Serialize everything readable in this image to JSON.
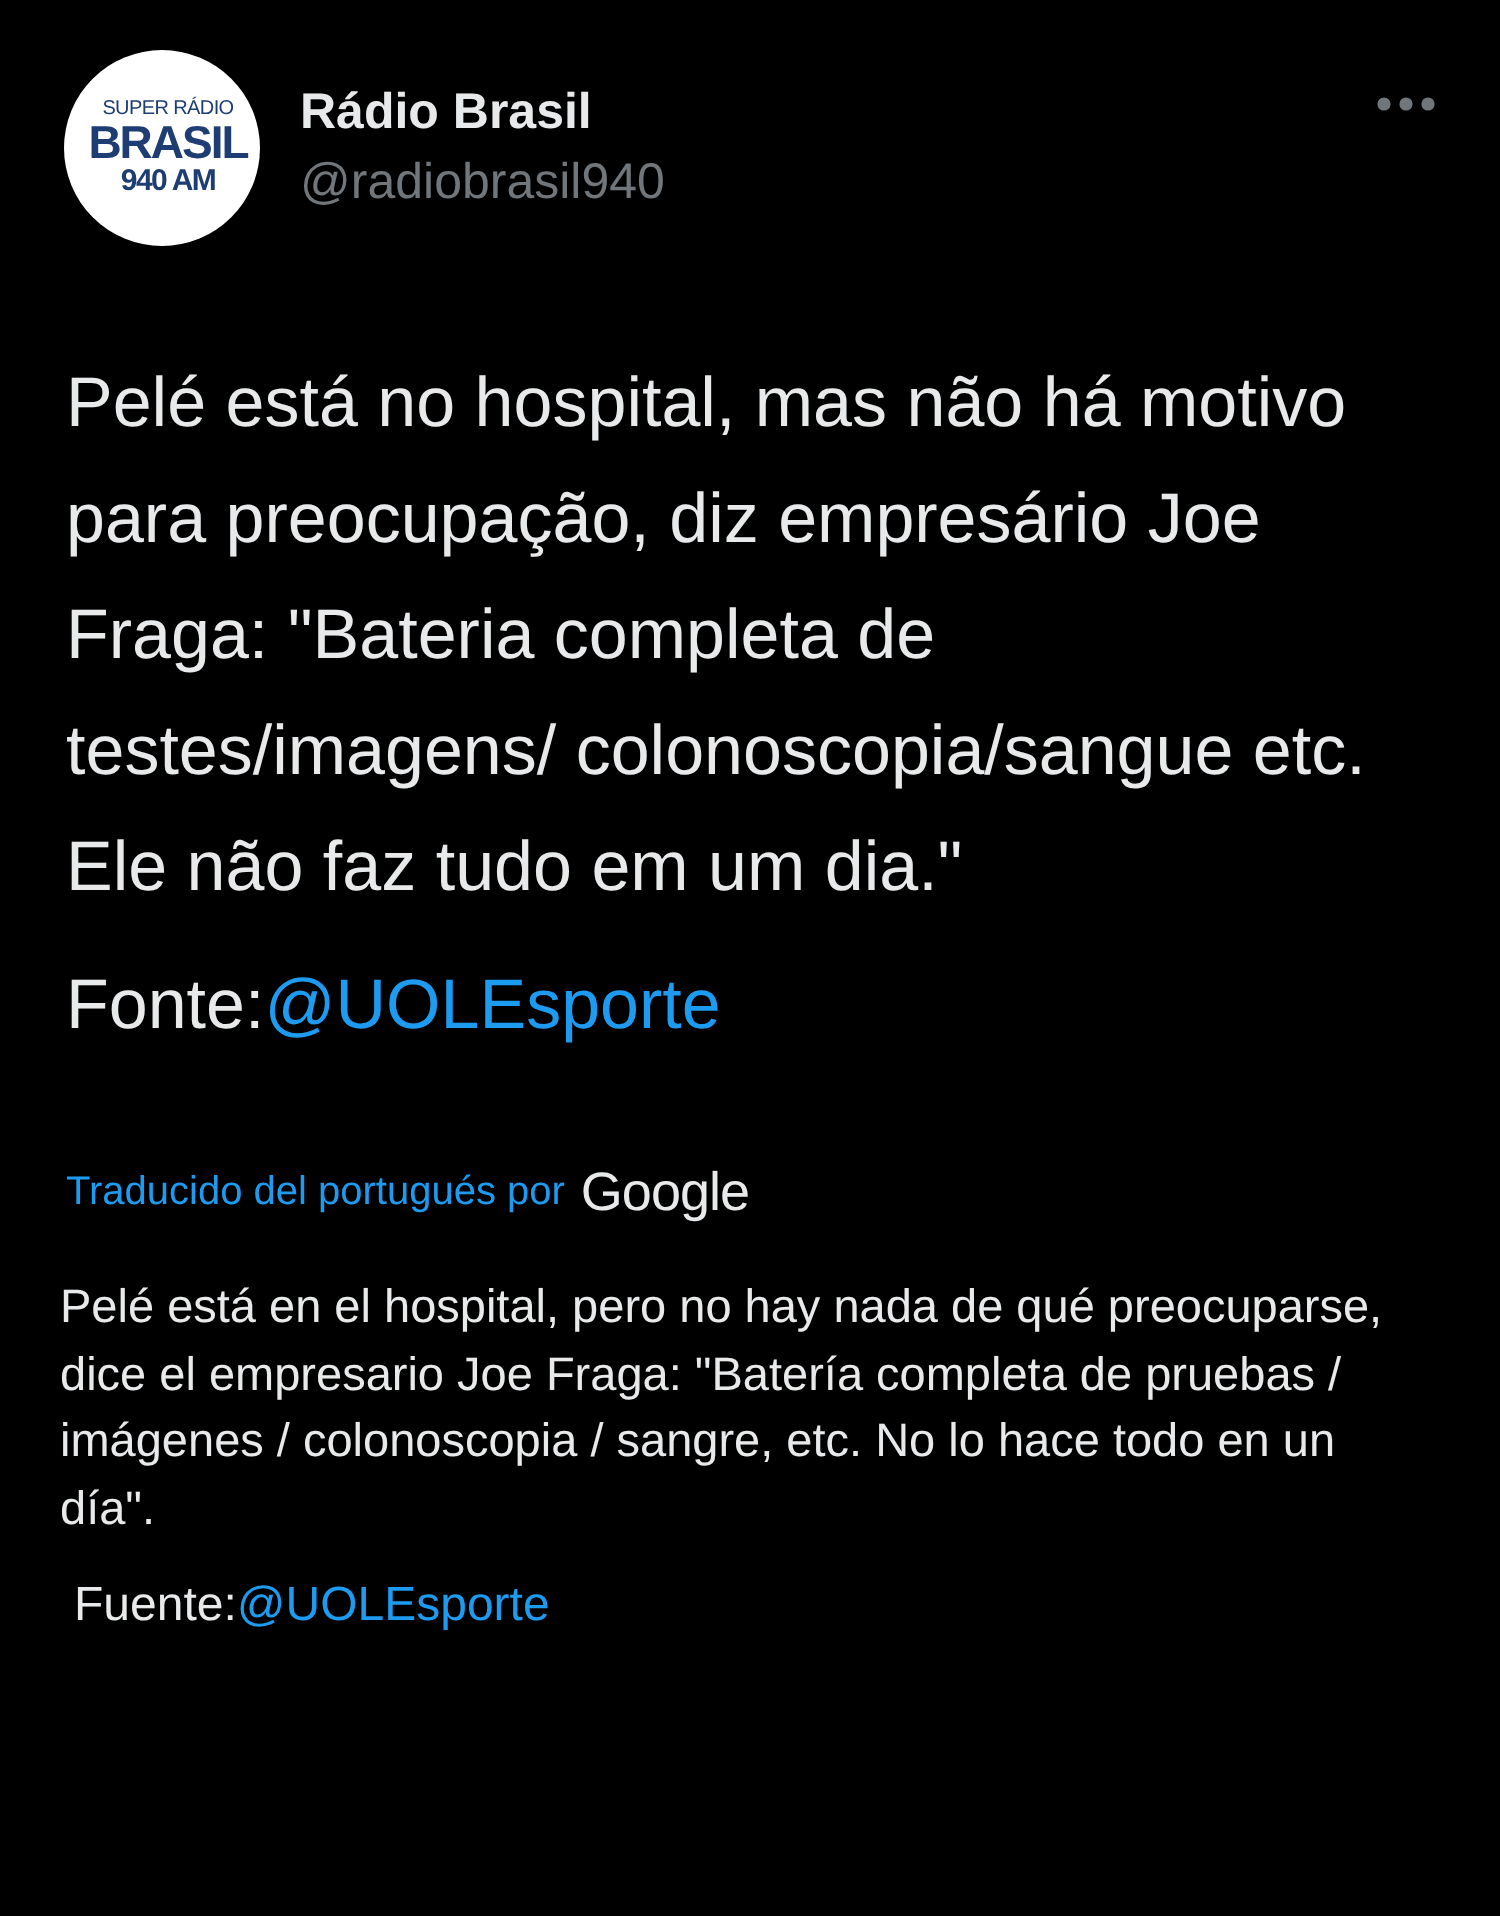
{
  "tweet": {
    "avatar": {
      "lines": [
        "SUPER RÁDIO",
        "BRASIL",
        "940 AM"
      ]
    },
    "name": "Rádio Brasil",
    "handle": "@radiobrasil940",
    "text": "Pelé está no hospital, mas não há motivo para preocupação, diz empresário Joe Fraga: \"Bateria completa de testes/imagens/ colonoscopia/sangue etc.  Ele não faz tudo em um dia.\"",
    "source": {
      "label": "Fonte:",
      "link": "@UOLEsporte"
    },
    "translation": {
      "label": "Traducido del portugués por",
      "provider": "Google",
      "text": "Pelé está en el hospital, pero no hay nada de qué preocuparse, dice el empresario Joe Fraga: \"Batería completa de pruebas / imágenes / colonoscopia / sangre, etc. No lo hace todo en un día\".",
      "source": {
        "label": "Fuente:",
        "link": "@UOLEsporte"
      }
    }
  }
}
